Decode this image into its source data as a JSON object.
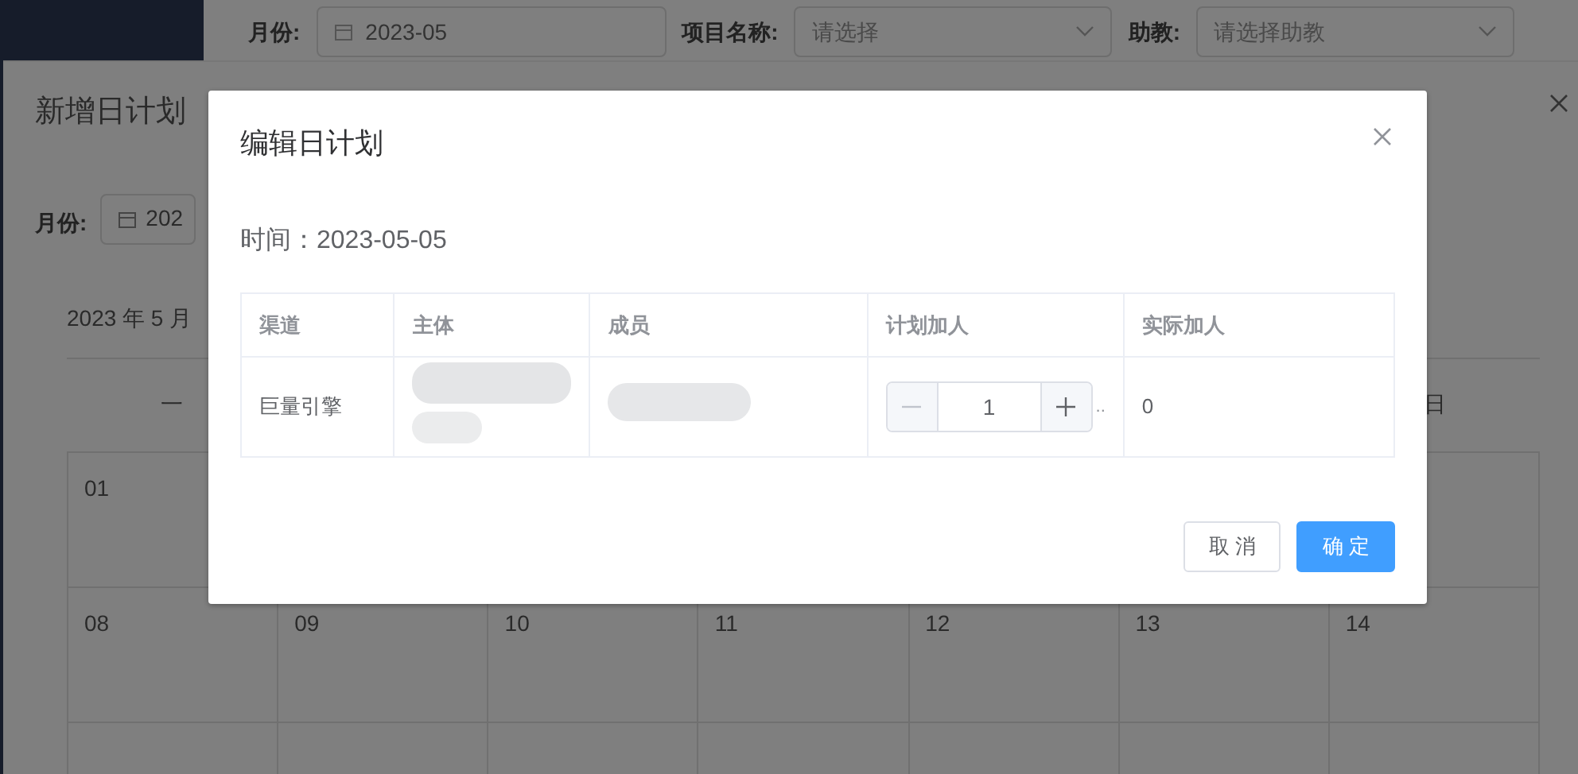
{
  "filter_bar": {
    "fields": [
      {
        "label": "月份:",
        "value": "2023-05",
        "kind": "date"
      },
      {
        "label": "项目名称:",
        "placeholder": "请选择",
        "kind": "select"
      },
      {
        "label": "助教:",
        "placeholder": "请选择助教",
        "kind": "select"
      }
    ]
  },
  "add_dialog": {
    "title": "新增日计划",
    "month_label": "月份:",
    "month_value": "202",
    "calendar_title": "2023 年 5 月",
    "weekday_first": "一",
    "weekday_last": "日",
    "weeks": [
      [
        "01"
      ],
      [
        "08",
        "09",
        "10",
        "11",
        "12",
        "13",
        "14"
      ]
    ]
  },
  "edit_dialog": {
    "title": "编辑日计划",
    "time": "时间：2023-05-05",
    "table": {
      "columns": [
        "渠道",
        "主体",
        "成员",
        "计划加人",
        "实际加人"
      ],
      "rows": [
        {
          "channel": "巨量引擎",
          "subject_blurred": true,
          "member_blurred": true,
          "planned": "1",
          "minus_disabled": true,
          "overflow_mark": "..",
          "actual": "0"
        }
      ]
    },
    "buttons": [
      {
        "label": "取 消",
        "kind": "default"
      },
      {
        "label": "确 定",
        "kind": "primary"
      }
    ]
  }
}
